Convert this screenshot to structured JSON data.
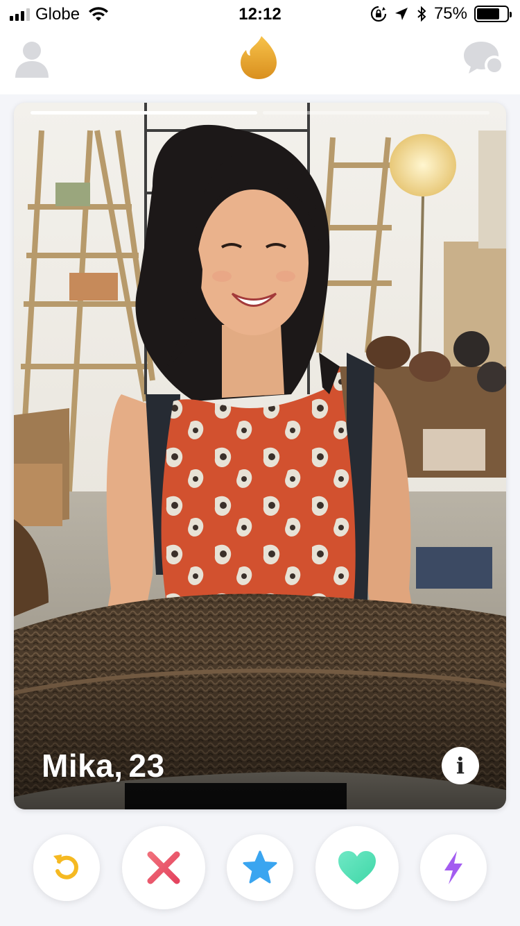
{
  "status_bar": {
    "carrier": "Globe",
    "time": "12:12",
    "battery_percent": "75%",
    "battery_level": 0.75
  },
  "nav": {
    "left_icon": "profile-icon",
    "center_icon": "flame-logo-icon",
    "right_icon": "messages-icon"
  },
  "card": {
    "name": "Mika,",
    "age": "23",
    "photo_count": 2,
    "active_photo": 1
  },
  "actions": [
    {
      "id": "rewind",
      "icon": "rewind-icon",
      "color": "#f5b922"
    },
    {
      "id": "nope",
      "icon": "close-icon",
      "color": "#ec5e6f"
    },
    {
      "id": "super-like",
      "icon": "star-icon",
      "color": "#3aa5f0"
    },
    {
      "id": "like",
      "icon": "heart-icon",
      "color": "#4ee1b4"
    },
    {
      "id": "boost",
      "icon": "lightning-icon",
      "color": "#a35cf0"
    }
  ],
  "colors": {
    "brand_gradient_start": "#f7c24a",
    "brand_gradient_end": "#d98f1e",
    "nav_icon_gray": "#d8d9dd"
  }
}
